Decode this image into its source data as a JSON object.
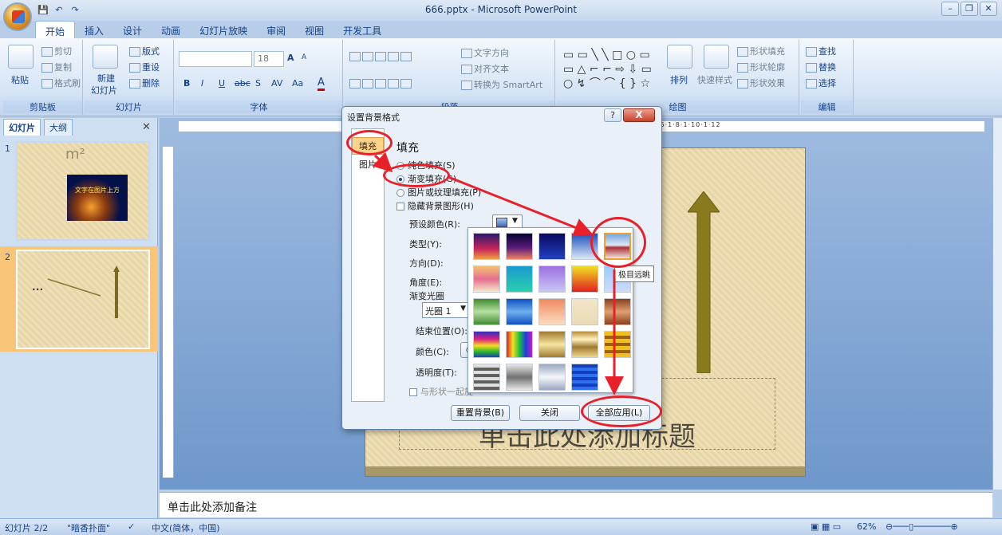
{
  "window": {
    "title": "666.pptx - Microsoft PowerPoint"
  },
  "qat": {
    "save": "💾",
    "undo": "↶",
    "redo": "↷"
  },
  "tabs": [
    "开始",
    "插入",
    "设计",
    "动画",
    "幻灯片放映",
    "审阅",
    "视图",
    "开发工具"
  ],
  "ribbon": {
    "clipboard": {
      "label": "剪贴板",
      "paste": "粘贴",
      "cut": "剪切",
      "copy": "复制",
      "format_painter": "格式刷"
    },
    "slides": {
      "label": "幻灯片",
      "new_slide": "新建",
      "new_slide2": "幻灯片",
      "layout": "版式",
      "reset": "重设",
      "delete": "删除"
    },
    "font": {
      "label": "字体",
      "size": "18",
      "bold": "B",
      "italic": "I",
      "underline": "U",
      "strike": "abc",
      "shadow": "S",
      "spacing": "AV",
      "case": "Aa",
      "grow": "A",
      "shrink": "A"
    },
    "paragraph": {
      "label": "段落",
      "text_direction": "文字方向",
      "align_text": "对齐文本",
      "smartart": "转换为 SmartArt"
    },
    "drawing": {
      "label": "绘图",
      "arrange": "排列",
      "quick_styles": "快速样式",
      "shape_fill": "形状填充",
      "shape_outline": "形状轮廓",
      "shape_effects": "形状效果"
    },
    "editing": {
      "label": "编辑",
      "find": "查找",
      "replace": "替换",
      "select": "选择"
    }
  },
  "left_panel": {
    "tab_slides": "幻灯片",
    "tab_outline": "大纲",
    "close": "✕",
    "slide1_num": "1",
    "slide2_num": "2",
    "slide1_title": "m²",
    "slide1_caption": "文字在图片上方",
    "slide2_dots": "•••"
  },
  "ruler": {
    "h_text": "·6·1·8·1·10·1·12"
  },
  "slide": {
    "placeholder": "单击此处添加标题"
  },
  "notes": {
    "placeholder": "单击此处添加备注"
  },
  "status": {
    "slide_count": "幻灯片 2/2",
    "theme": "\"暗香扑面\"",
    "language": "中文(简体，中国)",
    "zoom": "62%"
  },
  "dialog": {
    "title": "设置背景格式",
    "help": "?",
    "close": "X",
    "nav_fill": "填充",
    "nav_picture": "图片",
    "heading": "填充",
    "opt_solid": "纯色填充(S)",
    "opt_gradient": "渐变填充(G)",
    "opt_picture": "图片或纹理填充(P)",
    "opt_hide": "隐藏背景图形(H)",
    "preset_label": "预设颜色(R):",
    "type_label": "类型(Y):",
    "direction_label": "方向(D):",
    "angle_label": "角度(E):",
    "stops_label": "渐变光圈",
    "stop_value": "光圈 1",
    "end_pos_label": "结束位置(O):",
    "color_label": "颜色(C):",
    "transparency_label": "透明度(T):",
    "rotate_label": "与形状一起旋",
    "btn_reset": "重置背景(B)",
    "btn_close": "关闭",
    "btn_apply_all": "全部应用(L)"
  },
  "gallery": {
    "tooltip": "极目远眺",
    "swatches": [
      "linear-gradient(#2b1a6e,#c8235a 60%,#f0a040)",
      "linear-gradient(#050530,#5a1a7a 55%,#f08060)",
      "linear-gradient(#0a0a60,#2040c0)",
      "linear-gradient(#1a4fbf,#dde8f6)",
      "linear-gradient(#7aa8e0 0,#dde6f3 45%,#a8303a 55%,#f3e6e0 100%)",
      "linear-gradient(#f5c070,#e46f90 50%,#f7e9c8)",
      "linear-gradient(#1a9ad0,#2ad0b0)",
      "linear-gradient(#9b6fe0,#c9c7f5)",
      "linear-gradient(#f0e020,#e02020)",
      "linear-gradient(#99ccff,#ccddff)",
      "linear-gradient(#3f8a30,#b6e0a0 50%,#3f8a30)",
      "linear-gradient(#1050c0,#6fb0f0 50%,#1050c0)",
      "linear-gradient(#f08a60,#fbdcc0)",
      "linear-gradient(#f1e6c8,#e9dbb5)",
      "linear-gradient(#8a4020,#e0a070 50%,#8a4020)",
      "linear-gradient(#3030c0,#e02080 30%,#f0e020 55%,#20b030 80%,#2040c0)",
      "linear-gradient(90deg,#e02020,#f0e020,#20c040,#2040e0,#c020c0)",
      "linear-gradient(#a07a30,#f6e6a0 50%,#a07a30)",
      "linear-gradient(#b8903a,#fff2c0 30%,#a07a30 60%,#f0d890)",
      "repeating-linear-gradient(#f0c020 0 5px,#a06010 5px 9px)",
      "repeating-linear-gradient(#e0e0e0 0 4px,#606060 4px 8px)",
      "linear-gradient(#e8e8e8,#707070 50%,#e8e8e8)",
      "linear-gradient(#9aa8c0,#f4f6fa 50%,#9aa8c0)",
      "repeating-linear-gradient(#1040c0 0 4px,#3070f0 4px 8px)"
    ]
  }
}
